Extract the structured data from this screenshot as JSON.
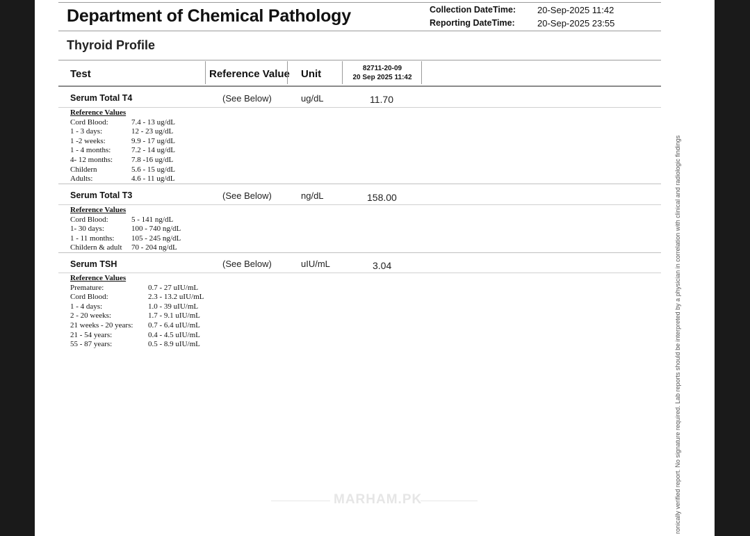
{
  "header": {
    "title": "Department of Chemical Pathology",
    "collection_label": "Collection DateTime:",
    "collection_value": "20-Sep-2025 11:42",
    "reporting_label": "Reporting DateTime:",
    "reporting_value": "20-Sep-2025 23:55"
  },
  "section_title": "Thyroid Profile",
  "table": {
    "col_test": "Test",
    "col_reference": "Reference Value",
    "col_unit": "Unit",
    "col_sample_id": "82711-20-09",
    "col_sample_date": "20 Sep 2025 11:42"
  },
  "tests": [
    {
      "name": "Serum Total T4",
      "reference": "(See Below)",
      "unit": "ug/dL",
      "result": "11.70",
      "ref_heading": "Reference Values",
      "ref_values": [
        {
          "label": "Cord Blood:",
          "value": "7.4 - 13 ug/dL"
        },
        {
          "label": "1 - 3 days:",
          "value": "12 - 23 ug/dL"
        },
        {
          "label": "1 -2 weeks:",
          "value": "9.9 - 17 ug/dL"
        },
        {
          "label": "1 - 4 months:",
          "value": "7.2 - 14 ug/dL"
        },
        {
          "label": "4- 12 months:",
          "value": "7.8 -16 ug/dL"
        },
        {
          "label": "Childern",
          "value": "5.6 - 15 ug/dL"
        },
        {
          "label": "Adults:",
          "value": "4.6 - 11 ug/dL"
        }
      ]
    },
    {
      "name": "Serum Total T3",
      "reference": "(See Below)",
      "unit": "ng/dL",
      "result": "158.00",
      "ref_heading": "Reference Values",
      "ref_values": [
        {
          "label": "Cord Blood:",
          "value": "5 - 141 ng/dL"
        },
        {
          "label": "1- 30 days:",
          "value": "100 - 740 ng/dL"
        },
        {
          "label": "1 - 11 months:",
          "value": "105 - 245 ng/dL"
        },
        {
          "label": "Childern & adult",
          "value": "70 - 204 ng/dL"
        }
      ]
    },
    {
      "name": "Serum TSH",
      "reference": "(See Below)",
      "unit": "uIU/mL",
      "result": "3.04",
      "ref_heading": "Reference Values",
      "ref_values": [
        {
          "label": "Premature:",
          "value": "0.7 - 27 uIU/mL"
        },
        {
          "label": "Cord Blood:",
          "value": "2.3 - 13.2 uIU/mL"
        },
        {
          "label": "1 - 4 days:",
          "value": "1.0 - 39 uIU/mL"
        },
        {
          "label": "2 - 20 weeks:",
          "value": "1.7 - 9.1 uIU/mL"
        },
        {
          "label": "21 weeks - 20 years:",
          "value": "0.7 - 6.4 uIU/mL"
        },
        {
          "label": "21 - 54 years:",
          "value": "0.4 - 4.5 uIU/mL"
        },
        {
          "label": "55 - 87 years:",
          "value": "0.5 - 8.9 uIU/mL"
        }
      ]
    }
  ],
  "side_note": "ronically verified report. No signature required. Lab reports should be interpreted by a physician in correlation with clinical and radiologic findings",
  "watermark": "MARHAM.PK"
}
